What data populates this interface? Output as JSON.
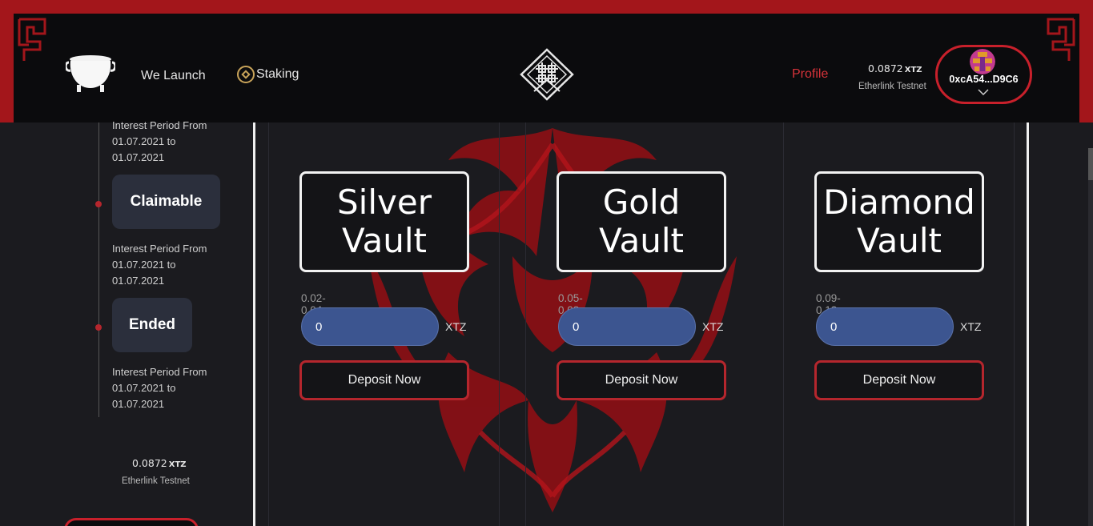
{
  "nav": {
    "we_launch": "We Launch",
    "staking": "Staking",
    "profile": "Profile"
  },
  "account": {
    "balance": "0.0872",
    "currency": "XTZ",
    "network": "Etherlink Testnet",
    "address": "0xcA54...D9C6"
  },
  "timeline": [
    {
      "interest": "Interest Period From 01.07.2021 to 01.07.2021"
    },
    {
      "status": "Claimable",
      "interest": "Interest Period From 01.07.2021 to 01.07.2021"
    },
    {
      "status": "Ended",
      "interest": "Interest Period From 01.07.2021 to 01.07.2021"
    }
  ],
  "vaults": [
    {
      "title_line1": "Silver",
      "title_line2": "Vault",
      "range": "0.02-0.04",
      "amount": "0",
      "unit": "XTZ",
      "deposit_label": "Deposit Now"
    },
    {
      "title_line1": "Gold",
      "title_line2": "Vault",
      "range": "0.05-0.08",
      "amount": "0",
      "unit": "XTZ",
      "deposit_label": "Deposit Now"
    },
    {
      "title_line1": "Diamond",
      "title_line2": "Vault",
      "range": "0.09-0.12",
      "amount": "0",
      "unit": "XTZ",
      "deposit_label": "Deposit Now"
    }
  ],
  "colors": {
    "accent_red": "#c8202b",
    "input_blue": "#3c5590",
    "background": "#1b1b1f"
  }
}
